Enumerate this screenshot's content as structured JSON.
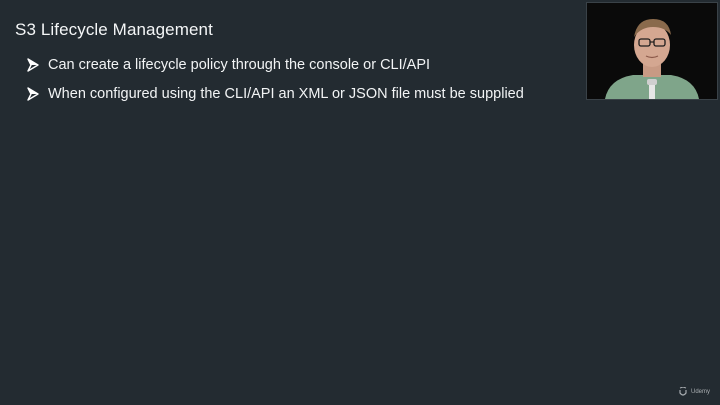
{
  "slide": {
    "title": "S3 Lifecycle Management",
    "bullets": [
      {
        "text": "Can create a lifecycle policy through the console or CLI/API"
      },
      {
        "text": "When configured using the CLI/API an XML or JSON file must be supplied"
      }
    ]
  },
  "webcam": {
    "icon": "presenter-video-icon"
  },
  "watermark": {
    "text": "Udemy",
    "icon": "udemy-logo-icon"
  },
  "colors": {
    "background": "#232b31",
    "text": "#ffffff"
  }
}
